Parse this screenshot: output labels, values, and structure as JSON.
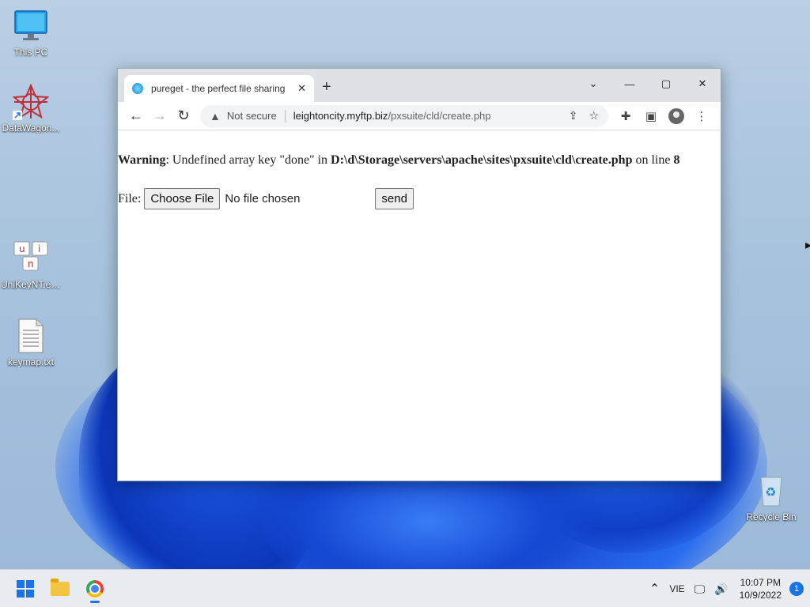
{
  "desktop": {
    "icons": [
      {
        "label": "This PC",
        "icon": "monitor-icon"
      },
      {
        "label": "DataWagon...",
        "icon": "datawagon-icon"
      },
      {
        "label": "UniKeyNT.exe",
        "icon": "unikey-icon"
      },
      {
        "label": "keymap.txt",
        "icon": "text-file-icon"
      },
      {
        "label": "Recycle Bin",
        "icon": "recycle-bin-icon"
      }
    ]
  },
  "browser": {
    "tab_title": "pureget - the perfect file sharing",
    "new_tab": "+",
    "omnibox": {
      "security_label": "Not secure",
      "host": "leightoncity.myftp.biz",
      "path": "/pxsuite/cld/create.php"
    }
  },
  "page": {
    "warning_label": "Warning",
    "warning_text": ": Undefined array key \"done\" in ",
    "warning_path": "D:\\d\\Storage\\servers\\apache\\sites\\pxsuite\\cld\\create.php",
    "warning_on": " on line ",
    "warning_line": "8",
    "file_label": "File:",
    "choose_file": "Choose File",
    "no_file": "No file chosen",
    "send": "send"
  },
  "taskbar": {
    "language": "VIE",
    "time": "10:07 PM",
    "date": "10/9/2022",
    "notifications": "1"
  },
  "colors": {
    "accent": "#1a73e8",
    "tab_strip": "#dee1e6"
  }
}
